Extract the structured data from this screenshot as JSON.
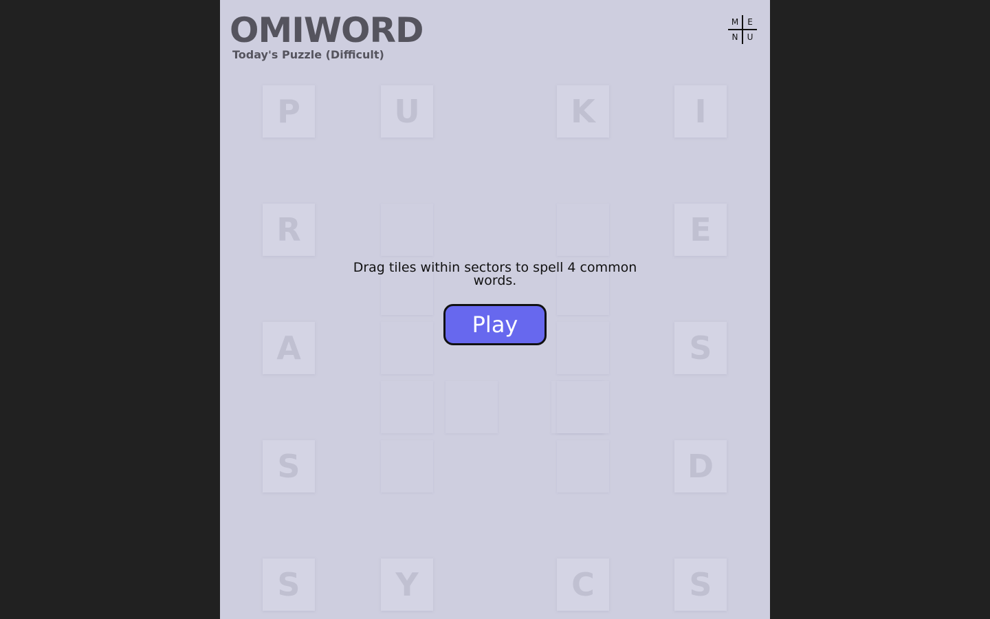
{
  "header": {
    "title": "OMIWORD",
    "subtitle": "Today's Puzzle (Difficult)"
  },
  "menu": {
    "letters": [
      "M",
      "E",
      "N",
      "U"
    ]
  },
  "board": {
    "tiles": [
      {
        "letter": "P",
        "col": 0,
        "row": 0
      },
      {
        "letter": "U",
        "col": 1,
        "row": 0
      },
      {
        "letter": "K",
        "col": 3,
        "row": 0
      },
      {
        "letter": "I",
        "col": 4,
        "row": 0
      },
      {
        "letter": "R",
        "col": 0,
        "row": 1
      },
      {
        "letter": "",
        "col": 1,
        "row": 1
      },
      {
        "letter": "",
        "col": 3,
        "row": 1
      },
      {
        "letter": "E",
        "col": 4,
        "row": 1
      },
      {
        "letter": "",
        "col": 1,
        "row": 1.5
      },
      {
        "letter": "",
        "col": 3,
        "row": 1.5
      },
      {
        "letter": "A",
        "col": 0,
        "row": 2
      },
      {
        "letter": "",
        "col": 1,
        "row": 2
      },
      {
        "letter": "",
        "col": 3,
        "row": 2
      },
      {
        "letter": "S",
        "col": 4,
        "row": 2
      },
      {
        "letter": "",
        "col": 1,
        "row": 2.5
      },
      {
        "letter": "",
        "col": 1.55,
        "row": 2.5
      },
      {
        "letter": "",
        "col": 2.45,
        "row": 2.5
      },
      {
        "letter": "",
        "col": 3,
        "row": 2.5
      },
      {
        "letter": "S",
        "col": 0,
        "row": 3
      },
      {
        "letter": "",
        "col": 1,
        "row": 3
      },
      {
        "letter": "",
        "col": 3,
        "row": 3
      },
      {
        "letter": "D",
        "col": 4,
        "row": 3
      },
      {
        "letter": "S",
        "col": 0,
        "row": 4
      },
      {
        "letter": "Y",
        "col": 1,
        "row": 4
      },
      {
        "letter": "C",
        "col": 3,
        "row": 4
      },
      {
        "letter": "S",
        "col": 4,
        "row": 4
      }
    ]
  },
  "modal": {
    "instructions": "Drag tiles within sectors to spell 4 common words.",
    "play_label": "Play"
  },
  "colors": {
    "page_background": "#212121",
    "app_background": "#ceceDF",
    "accent": "#6768ee",
    "title_text": "#55545e"
  }
}
